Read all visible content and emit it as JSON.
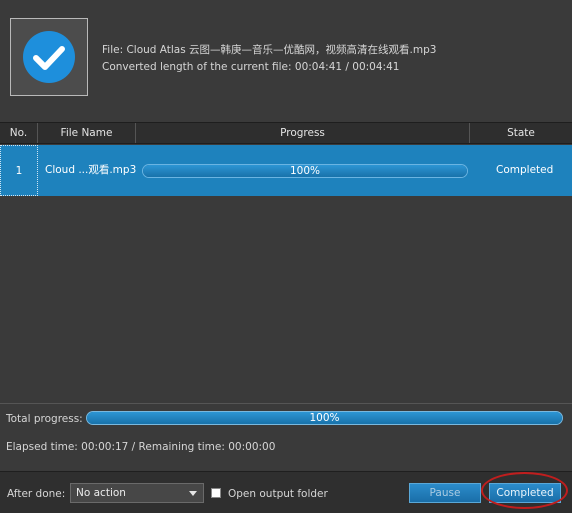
{
  "header": {
    "file_line": "File: Cloud Atlas 云图—韩庚—音乐—优酷网，视频高清在线观看.mp3",
    "converted_line": "Converted length of the current file: 00:04:41 / 00:04:41",
    "status_icon": "check-circle-icon"
  },
  "table": {
    "columns": [
      "No.",
      "File Name",
      "Progress",
      "State"
    ],
    "rows": [
      {
        "no": "1",
        "name": "Cloud ...观看.mp3",
        "progress_label": "100%",
        "progress": 1.0,
        "state": "Completed"
      }
    ]
  },
  "status": {
    "total_label": "Total progress:",
    "total_text": "100%",
    "total": 1.0,
    "time_line": "Elapsed time: 00:00:17 / Remaining time: 00:00:00"
  },
  "footer": {
    "after_done_label": "After done:",
    "after_done_value": "No action",
    "open_folder_label": "Open output folder",
    "open_folder_checked": false,
    "pause_label": "Pause",
    "completed_label": "Completed"
  },
  "colors": {
    "accent": "#1e82bd",
    "background": "#3a3a3a",
    "highlight": "#c01e1e"
  }
}
